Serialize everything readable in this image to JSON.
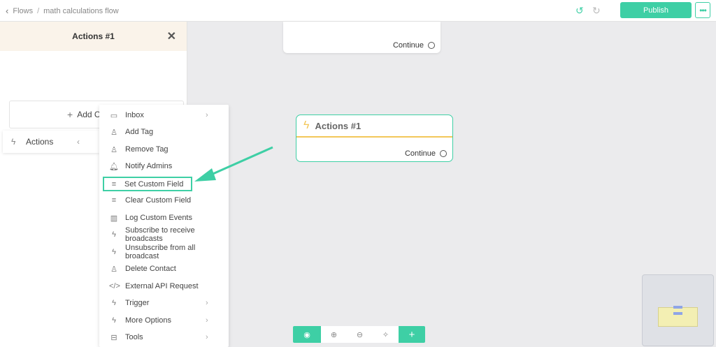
{
  "topbar": {
    "breadcrumb_root": "Flows",
    "breadcrumb_sep": "/",
    "breadcrumb_current": "math calculations flow",
    "publish_label": "Publish",
    "more_label": "•••"
  },
  "panel": {
    "title": "Actions #1",
    "add_label": "Add C"
  },
  "submenu": {
    "label": "Actions"
  },
  "dropdown": {
    "items": [
      {
        "label": "Inbox",
        "icon": "chat-icon",
        "has_arrow": true
      },
      {
        "label": "Add Tag",
        "icon": "user-tag-icon"
      },
      {
        "label": "Remove Tag",
        "icon": "user-tag-icon"
      },
      {
        "label": "Notify Admins",
        "icon": "bell-icon"
      },
      {
        "label": "Set Custom Field",
        "icon": "database-icon",
        "highlighted": true
      },
      {
        "label": "Clear Custom Field",
        "icon": "database-icon"
      },
      {
        "label": "Log Custom Events",
        "icon": "chart-icon"
      },
      {
        "label": "Subscribe to receive broadcasts",
        "icon": "bolt-icon"
      },
      {
        "label": "Unsubscribe from all broadcast",
        "icon": "bolt-icon"
      },
      {
        "label": "Delete Contact",
        "icon": "user-x-icon"
      },
      {
        "label": "External API Request",
        "icon": "code-icon"
      },
      {
        "label": "Trigger",
        "icon": "bolt-icon",
        "has_arrow": true
      },
      {
        "label": "More Options",
        "icon": "bolt-icon",
        "has_arrow": true
      },
      {
        "label": "Tools",
        "icon": "toolbox-icon",
        "has_arrow": true
      }
    ]
  },
  "canvas": {
    "top_node_continue": "Continue",
    "node_title": "Actions #1",
    "node_continue": "Continue"
  },
  "colors": {
    "accent": "#3ecfa5",
    "node_divider": "#f3c75a"
  }
}
